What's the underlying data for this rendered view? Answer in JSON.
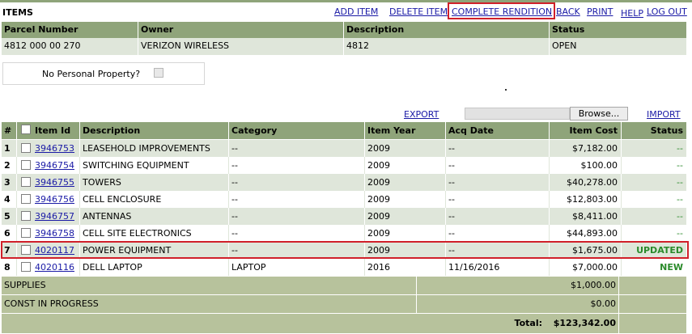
{
  "page_title": "ITEMS",
  "nav": {
    "add_item": "ADD ITEM",
    "delete_item": "DELETE ITEM",
    "complete_rendition": "COMPLETE RENDITION",
    "back": "BACK",
    "print": "PRINT",
    "help": "HELP",
    "logout": "LOG OUT"
  },
  "parcel": {
    "headers": [
      "Parcel Number",
      "Owner",
      "Description",
      "Status"
    ],
    "values": [
      "4812 000 00 270",
      "VERIZON WIRELESS",
      "4812",
      "OPEN"
    ]
  },
  "no_personal_property_label": "No Personal Property?",
  "actions": {
    "export": "EXPORT",
    "browse": "Browse...",
    "import": "IMPORT"
  },
  "items_table": {
    "headers": [
      "#",
      "Item Id",
      "Description",
      "Category",
      "Item Year",
      "Acq Date",
      "Item Cost",
      "Status"
    ],
    "rows": [
      {
        "num": "1",
        "id": "3946753",
        "description": "LEASEHOLD IMPROVEMENTS",
        "category": "--",
        "year": "2009",
        "acq_date": "--",
        "cost": "$7,182.00",
        "status": "--"
      },
      {
        "num": "2",
        "id": "3946754",
        "description": "SWITCHING EQUIPMENT",
        "category": "--",
        "year": "2009",
        "acq_date": "--",
        "cost": "$100.00",
        "status": "--"
      },
      {
        "num": "3",
        "id": "3946755",
        "description": "TOWERS",
        "category": "--",
        "year": "2009",
        "acq_date": "--",
        "cost": "$40,278.00",
        "status": "--"
      },
      {
        "num": "4",
        "id": "3946756",
        "description": "CELL ENCLOSURE",
        "category": "--",
        "year": "2009",
        "acq_date": "--",
        "cost": "$12,803.00",
        "status": "--"
      },
      {
        "num": "5",
        "id": "3946757",
        "description": "ANTENNAS",
        "category": "--",
        "year": "2009",
        "acq_date": "--",
        "cost": "$8,411.00",
        "status": "--"
      },
      {
        "num": "6",
        "id": "3946758",
        "description": "CELL SITE ELECTRONICS",
        "category": "--",
        "year": "2009",
        "acq_date": "--",
        "cost": "$44,893.00",
        "status": "--"
      },
      {
        "num": "7",
        "id": "4020117",
        "description": "POWER EQUIPMENT",
        "category": "--",
        "year": "2009",
        "acq_date": "--",
        "cost": "$1,675.00",
        "status": "UPDATED"
      },
      {
        "num": "8",
        "id": "4020116",
        "description": "DELL LAPTOP",
        "category": "LAPTOP",
        "year": "2016",
        "acq_date": "11/16/2016",
        "cost": "$7,000.00",
        "status": "NEW"
      }
    ]
  },
  "summary": {
    "supplies_label": "SUPPLIES",
    "supplies_value": "$1,000.00",
    "cip_label": "CONST IN PROGRESS",
    "cip_value": "$0.00",
    "total_label": "Total:",
    "total_value": "$123,342.00"
  },
  "colors": {
    "header_bg": "#8fa47a",
    "row_alt_bg": "#dfe6da",
    "summary_bg": "#b7c29c",
    "link": "#1a1aa6",
    "highlight": "#d0202a",
    "status_green": "#2a8a2a"
  }
}
